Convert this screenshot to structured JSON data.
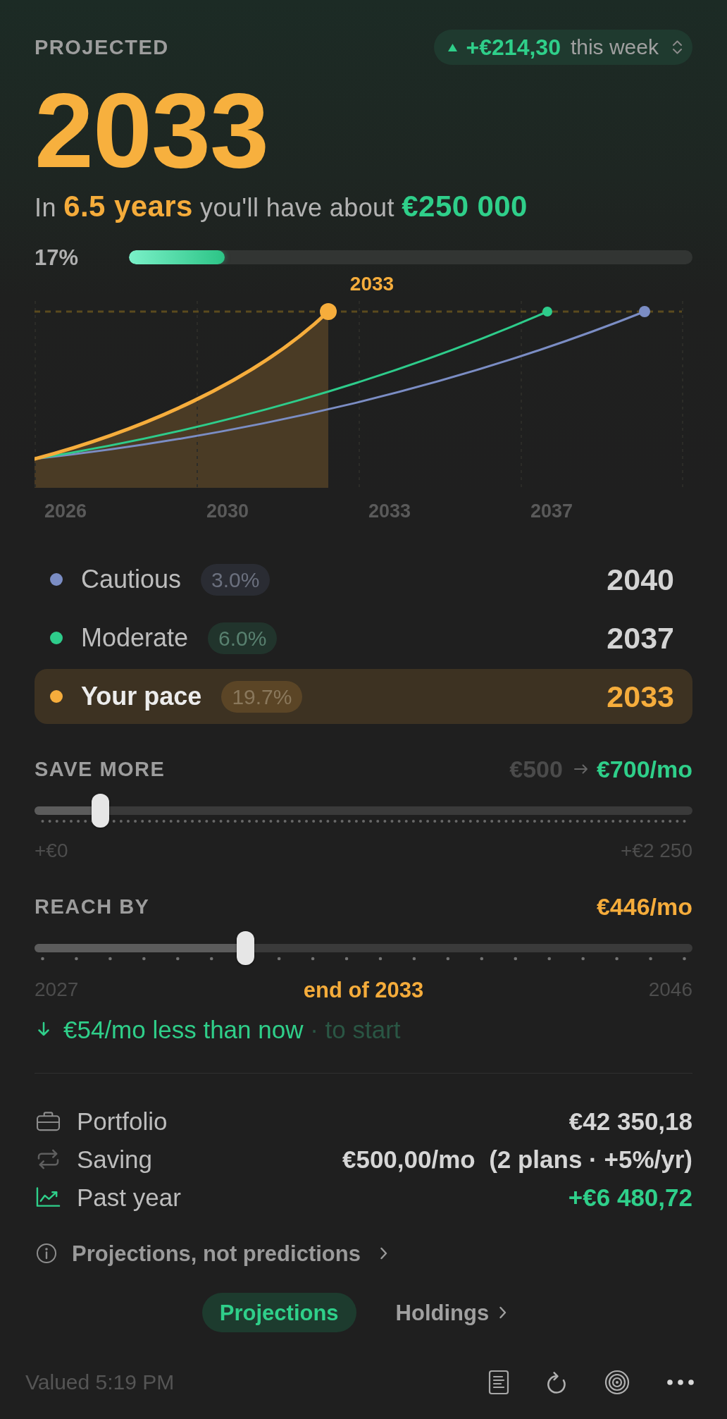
{
  "header": {
    "label": "PROJECTED",
    "weekly_change": {
      "amount": "+€214,30",
      "period": "this week"
    }
  },
  "projection": {
    "year": "2033",
    "summary": [
      {
        "kind": "plain",
        "text": "In"
      },
      {
        "kind": "duration",
        "text": "6.5 years"
      },
      {
        "kind": "plain",
        "text": "you'll have about"
      },
      {
        "kind": "amount",
        "text": "€250 000"
      }
    ]
  },
  "progress": {
    "label": "17%",
    "level": 0.17
  },
  "chart": {
    "callout": "2033",
    "x_labels": [
      "2026",
      "2030",
      "2033",
      "2037"
    ]
  },
  "scenarios": [
    {
      "name": "Cautious",
      "rate": "3.0%",
      "year": "2040",
      "color": "#7b8dc4",
      "selected": false
    },
    {
      "name": "Moderate",
      "rate": "6.0%",
      "year": "2037",
      "color": "#2ecc8b",
      "selected": false
    },
    {
      "name": "Your pace",
      "rate": "19.7%",
      "year": "2033",
      "color": "#f6ad3c",
      "selected": true
    }
  ],
  "save_more": {
    "label": "SAVE MORE",
    "current": "€500",
    "new": "€700/mo",
    "level": 0.089,
    "min": "+€0",
    "max": "+€2 250"
  },
  "reach_by": {
    "label": "REACH BY",
    "amount": "€446/mo",
    "level": 0.316,
    "min": "2027",
    "value": "end of 2033",
    "max": "2046",
    "note": "€54/mo less than now",
    "note_suffix": "· to start"
  },
  "summary_rows": [
    {
      "kind": "portfolio",
      "label": "Portfolio",
      "value": "€42 350,18"
    },
    {
      "kind": "saving",
      "label": "Saving",
      "value": "€500,00/mo  (2 plans · +5%/yr)"
    },
    {
      "kind": "past_year",
      "label": "Past year",
      "value": "+€6 480,72"
    }
  ],
  "disclaimer": "Projections, not predictions",
  "tabs": [
    {
      "label": "Projections",
      "selected": true
    },
    {
      "label": "Holdings",
      "selected": false
    }
  ],
  "footer": {
    "valued": "Valued 5:19 PM"
  }
}
